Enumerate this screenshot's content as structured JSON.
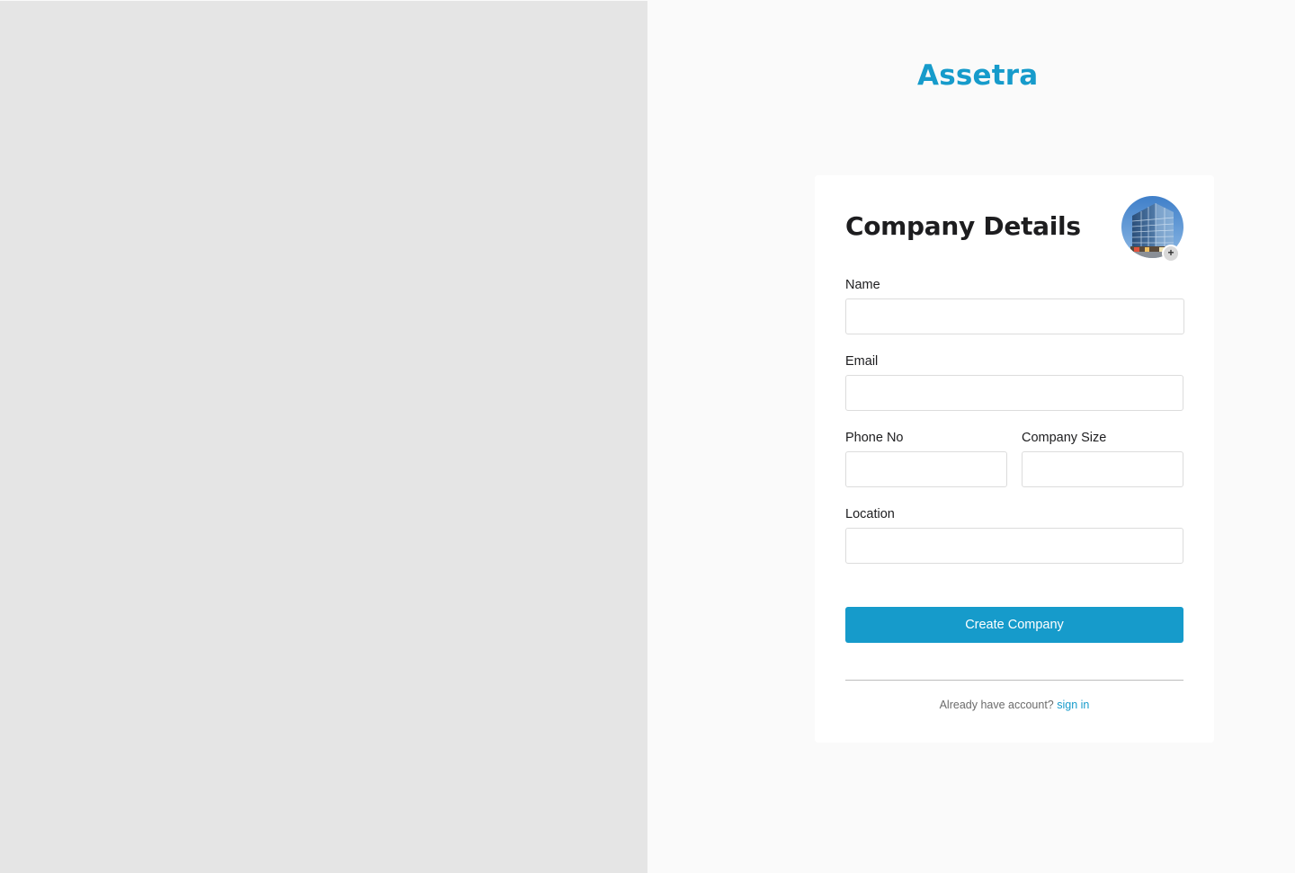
{
  "brand": {
    "name": "Assetra",
    "color": "#169bcb"
  },
  "form": {
    "title": "Company Details",
    "avatar": {
      "icon": "building-photo-icon",
      "add_symbol": "+"
    },
    "fields": {
      "name": {
        "label": "Name",
        "value": "",
        "placeholder": ""
      },
      "email": {
        "label": "Email",
        "value": "",
        "placeholder": ""
      },
      "phone": {
        "label": "Phone No",
        "value": "",
        "placeholder": ""
      },
      "company_size": {
        "label": "Company Size",
        "value": "",
        "placeholder": ""
      },
      "location": {
        "label": "Location",
        "value": "",
        "placeholder": ""
      }
    },
    "submit_label": "Create Company",
    "signin_prompt": "Already have account?",
    "signin_link": "sign in"
  },
  "colors": {
    "accent": "#169bcb",
    "left_panel": "#e5e5e5",
    "background": "#fafafa",
    "card": "#ffffff"
  }
}
